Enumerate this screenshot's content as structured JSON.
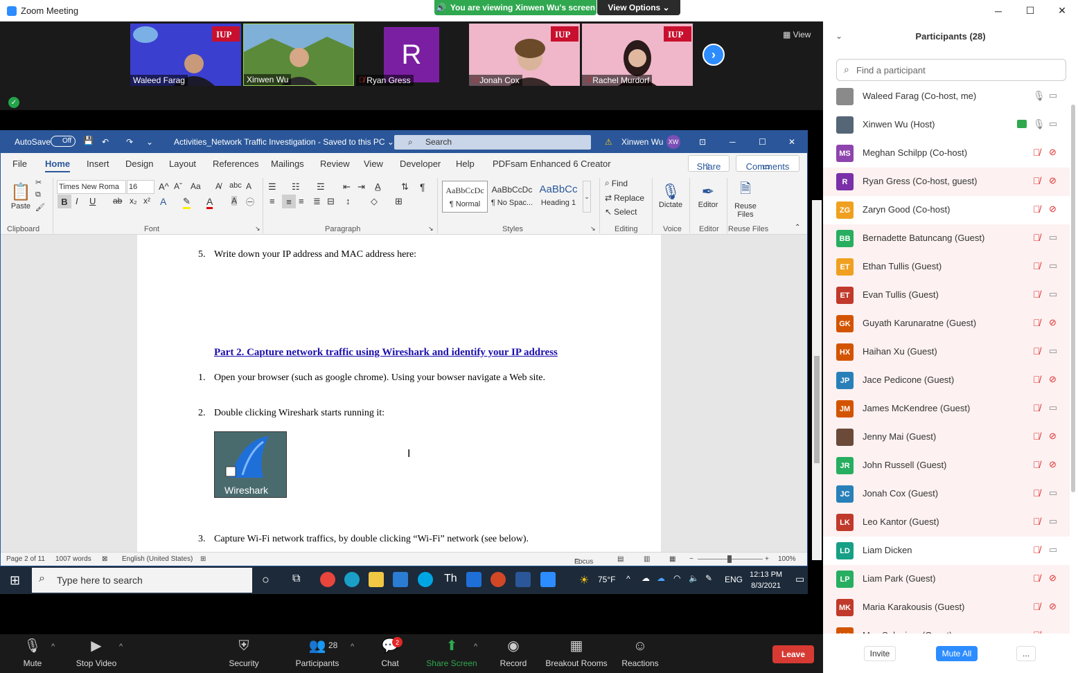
{
  "window": {
    "title": "Zoom Meeting",
    "minimize": "─",
    "maximize": "☐",
    "close": "✕"
  },
  "banner": {
    "viewing": "You are viewing Xinwen Wu's screen",
    "view_options": "View Options ⌄"
  },
  "video": {
    "view_label": "View",
    "tiles": [
      {
        "name": "Waleed Farag",
        "muted": false,
        "bg": "#3b3fcf"
      },
      {
        "name": "Xinwen Wu",
        "muted": false,
        "bg": "#5a8a3c"
      },
      {
        "name": "Ryan Gress",
        "muted": true,
        "bg": "#1a1a1a",
        "initial": "R"
      },
      {
        "name": "Jonah Cox",
        "muted": true,
        "bg": "#e9b8c8"
      },
      {
        "name": "Rachel Murdorf",
        "muted": true,
        "bg": "#e9b8c8"
      }
    ]
  },
  "word": {
    "autosave": "AutoSave",
    "autosave_state": "Off",
    "doc_title": "Activities_Network Traffic Investigation  -  Saved to this PC ⌄",
    "search": "Search",
    "user": "Xinwen Wu",
    "user_initials": "XW",
    "tabs": [
      "File",
      "Home",
      "Insert",
      "Design",
      "Layout",
      "References",
      "Mailings",
      "Review",
      "View",
      "Developer",
      "Help",
      "PDFsam Enhanced 6 Creator"
    ],
    "share": "Share",
    "comments": "Comments",
    "ribbon": {
      "paste": "Paste",
      "clipboard": "Clipboard",
      "font_name": "Times New Roma",
      "font_size": "16",
      "font": "Font",
      "paragraph": "Paragraph",
      "styles": "Styles",
      "style_items": [
        {
          "preview": "AaBbCcDc",
          "name": "¶ Normal"
        },
        {
          "preview": "AaBbCcDc",
          "name": "¶ No Spac..."
        },
        {
          "preview": "AaBbCc",
          "name": "Heading 1"
        }
      ],
      "find": "Find",
      "replace": "Replace",
      "select": "Select",
      "editing": "Editing",
      "dictate": "Dictate",
      "voice": "Voice",
      "editor": "Editor",
      "editor_group": "Editor",
      "reuse": "Reuse Files",
      "reuse_group": "Reuse Files",
      "bold": "B",
      "italic": "I",
      "underline": "U"
    },
    "doc": {
      "item5_num": "5.",
      "item5": "Write down your IP address and MAC address here:",
      "heading": "Part 2. Capture network traffic using Wireshark and identify your IP address",
      "item1_num": "1.",
      "item1": "Open your browser (such as google chrome). Using your bowser navigate a Web site.",
      "item2_num": "2.",
      "item2": "Double clicking Wireshark starts running it:",
      "wireshark_label": "Wireshark",
      "item3_num": "3.",
      "item3": "Capture Wi-Fi network traffics, by double clicking “Wi-Fi” network (see below)."
    },
    "status": {
      "page": "Page 2 of 11",
      "words": "1007 words",
      "language": "English (United States)",
      "focus": "Focus",
      "zoom": "100%"
    }
  },
  "taskbar": {
    "search": "Type here to search",
    "weather": "75°F",
    "lang": "ENG",
    "time": "12:13 PM",
    "date": "8/3/2021"
  },
  "toolbar": {
    "mute": "Mute",
    "stop_video": "Stop Video",
    "security": "Security",
    "participants": "Participants",
    "participants_count": "28",
    "chat": "Chat",
    "chat_badge": "2",
    "share_screen": "Share Screen",
    "record": "Record",
    "breakout": "Breakout Rooms",
    "reactions": "Reactions",
    "leave": "Leave"
  },
  "panel": {
    "title": "Participants (28)",
    "find_placeholder": "Find a participant",
    "participants": [
      {
        "initials": "",
        "name": "Waleed Farag (Co-host, me)",
        "color": "#8a8a8a",
        "photo": true,
        "mic_muted": false,
        "cam_off": false,
        "hl": false
      },
      {
        "initials": "",
        "name": "Xinwen Wu (Host)",
        "color": "#556677",
        "photo": true,
        "mic_muted": false,
        "cam_off": false,
        "hl": false,
        "sharing": true
      },
      {
        "initials": "MS",
        "name": "Meghan Schilpp (Co-host)",
        "color": "#8e44ad",
        "mic_muted": true,
        "cam_off": true,
        "hl": false
      },
      {
        "initials": "R",
        "name": "Ryan Gress (Co-host, guest)",
        "color": "#7b2fa8",
        "mic_muted": true,
        "cam_off": true,
        "hl": true
      },
      {
        "initials": "ZG",
        "name": "Zaryn Good (Co-host)",
        "color": "#f0a020",
        "mic_muted": true,
        "cam_off": true,
        "hl": false
      },
      {
        "initials": "BB",
        "name": "Bernadette Batuncang (Guest)",
        "color": "#27ae60",
        "mic_muted": true,
        "cam_off": false,
        "hl": true
      },
      {
        "initials": "ET",
        "name": "Ethan Tullis (Guest)",
        "color": "#f0a020",
        "mic_muted": true,
        "cam_off": false,
        "hl": true
      },
      {
        "initials": "ET",
        "name": "Evan Tullis (Guest)",
        "color": "#c0392b",
        "mic_muted": true,
        "cam_off": false,
        "hl": true
      },
      {
        "initials": "GK",
        "name": "Guyath Karunaratne (Guest)",
        "color": "#d35400",
        "mic_muted": true,
        "cam_off": true,
        "hl": true
      },
      {
        "initials": "HX",
        "name": "Haihan Xu (Guest)",
        "color": "#d35400",
        "mic_muted": true,
        "cam_off": false,
        "hl": true
      },
      {
        "initials": "JP",
        "name": "Jace Pedicone (Guest)",
        "color": "#2980b9",
        "mic_muted": true,
        "cam_off": true,
        "hl": true
      },
      {
        "initials": "JM",
        "name": "James McKendree (Guest)",
        "color": "#d35400",
        "mic_muted": true,
        "cam_off": false,
        "hl": true
      },
      {
        "initials": "",
        "name": "Jenny Mai (Guest)",
        "color": "#6b4a3a",
        "photo": true,
        "mic_muted": true,
        "cam_off": true,
        "hl": true
      },
      {
        "initials": "JR",
        "name": "John Russell (Guest)",
        "color": "#27ae60",
        "mic_muted": true,
        "cam_off": true,
        "hl": true
      },
      {
        "initials": "JC",
        "name": "Jonah Cox (Guest)",
        "color": "#2980b9",
        "mic_muted": true,
        "cam_off": false,
        "hl": true
      },
      {
        "initials": "LK",
        "name": "Leo Kantor (Guest)",
        "color": "#c0392b",
        "mic_muted": true,
        "cam_off": false,
        "hl": true
      },
      {
        "initials": "LD",
        "name": "Liam Dicken",
        "color": "#16a085",
        "mic_muted": true,
        "cam_off": false,
        "hl": false
      },
      {
        "initials": "LP",
        "name": "Liam Park (Guest)",
        "color": "#27ae60",
        "mic_muted": true,
        "cam_off": true,
        "hl": true
      },
      {
        "initials": "MK",
        "name": "Maria Karakousis (Guest)",
        "color": "#c0392b",
        "mic_muted": true,
        "cam_off": true,
        "hl": true
      },
      {
        "initials": "MS",
        "name": "Max Salagiver (Guest)",
        "color": "#d35400",
        "mic_muted": true,
        "cam_off": false,
        "hl": true
      }
    ],
    "invite": "Invite",
    "mute_all": "Mute All",
    "more": "..."
  }
}
